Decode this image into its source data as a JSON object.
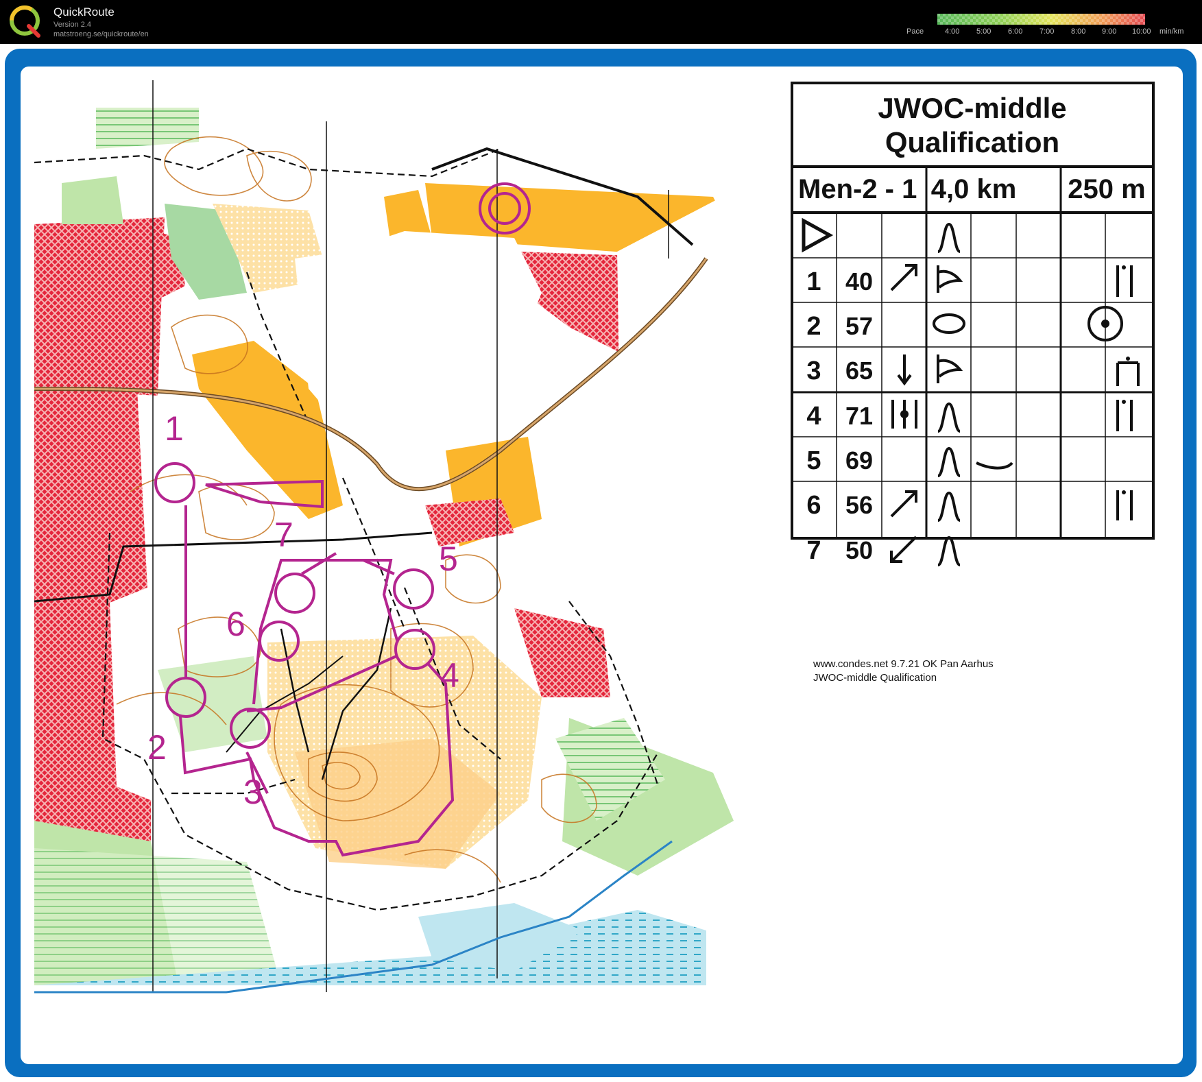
{
  "app": {
    "title": "QuickRoute",
    "version": "Version 2.4",
    "url": "matstroeng.se/quickroute/en",
    "logo_letter": "Q"
  },
  "pace_scale": {
    "label": "Pace",
    "ticks": [
      "4:00",
      "5:00",
      "6:00",
      "7:00",
      "8:00",
      "9:00",
      "10:00"
    ],
    "unit": "min/km"
  },
  "control_description": {
    "title_line1": "JWOC-middle",
    "title_line2": "Qualification",
    "class": "Men-2 - 1",
    "length": "4,0 km",
    "climb": "250 m",
    "rows": [
      {
        "num": "1",
        "code": "40",
        "dir": "ne-arrow",
        "feature": "spur",
        "extra": "",
        "loc": "ruined-wall"
      },
      {
        "num": "2",
        "code": "57",
        "dir": "",
        "feature": "depression",
        "extra": "",
        "loc": "circle-dot"
      },
      {
        "num": "3",
        "code": "65",
        "dir": "down-arrow",
        "feature": "spur",
        "extra": "",
        "loc": "foot-of"
      },
      {
        "num": "4",
        "code": "71",
        "dir": "between",
        "feature": "hill",
        "extra": "",
        "loc": "ruined-wall"
      },
      {
        "num": "5",
        "code": "69",
        "dir": "",
        "feature": "hill",
        "extra": "curve",
        "loc": ""
      },
      {
        "num": "6",
        "code": "56",
        "dir": "ne-arrow",
        "feature": "hill",
        "extra": "",
        "loc": "ruined-wall"
      },
      {
        "num": "7",
        "code": "50",
        "dir": "sw-arrow",
        "feature": "hill",
        "extra": "",
        "loc": ""
      }
    ],
    "footer1": "www.condes.net 9.7.21 OK Pan Aarhus",
    "footer2": "JWOC-middle Qualification"
  },
  "course_labels": [
    "1",
    "2",
    "3",
    "4",
    "5",
    "6",
    "7"
  ],
  "colors": {
    "frame_blue": "#0a6fc0",
    "course_purple": "#b4258f",
    "forest_green": "#bfe5a9",
    "open_yellow": "#fbb62c",
    "private_red": "#e4263c"
  }
}
